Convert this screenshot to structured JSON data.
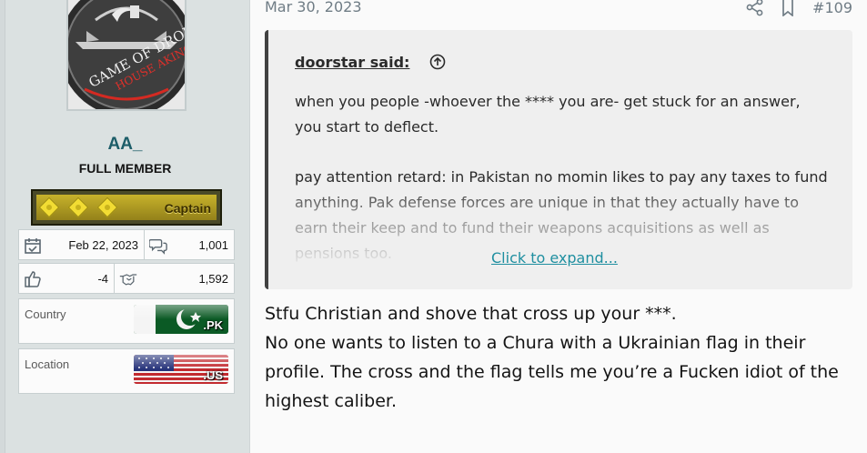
{
  "user": {
    "name": "AA_",
    "title": "FULL MEMBER",
    "rank": "Captain",
    "joined": "Feb 22, 2023",
    "messages": "1,001",
    "reactions": "-4",
    "points": "1,592",
    "country_label": "Country",
    "country_code": ".PK",
    "location_label": "Location",
    "location_code": ".US",
    "avatar_text": "GAME OF DRONES",
    "avatar_subtext": "HOUSE AKING"
  },
  "post": {
    "date": "Mar 30, 2023",
    "number": "#109"
  },
  "quote": {
    "author": "doorstar said:",
    "paragraph1": "when you people -whoever the **** you are- get stuck for an answer, you start to deflect.",
    "paragraph2": "pay attention retard: in Pakistan no momin likes to pay any taxes to fund anything. Pak defense forces are unique in that they actually have to earn their keep and to fund their weapons acquisitions as well as pensions too.",
    "expand_label": "Click to expand..."
  },
  "message": {
    "line1": "Stfu Christian and shove that cross up your ***.",
    "line2": "No one wants to listen to a Chura with a Ukrainian flag in their profile. The cross and the flag tells me you’re a Fucken idiot of the highest caliber."
  },
  "colors": {
    "sidebar_bg": "#dbe1e1",
    "username": "#1c5d68",
    "link": "#1f8fa0",
    "quote_bar": "#424242",
    "rank_gold": "#c7b22b"
  },
  "icons": {
    "joined": "calendar-check-icon",
    "messages": "speech-bubbles-icon",
    "reactions": "thumbs-up-icon",
    "points": "handshake-icon",
    "share": "share-icon",
    "bookmark": "bookmark-icon",
    "quote_jump": "arrow-up-circle-icon"
  }
}
